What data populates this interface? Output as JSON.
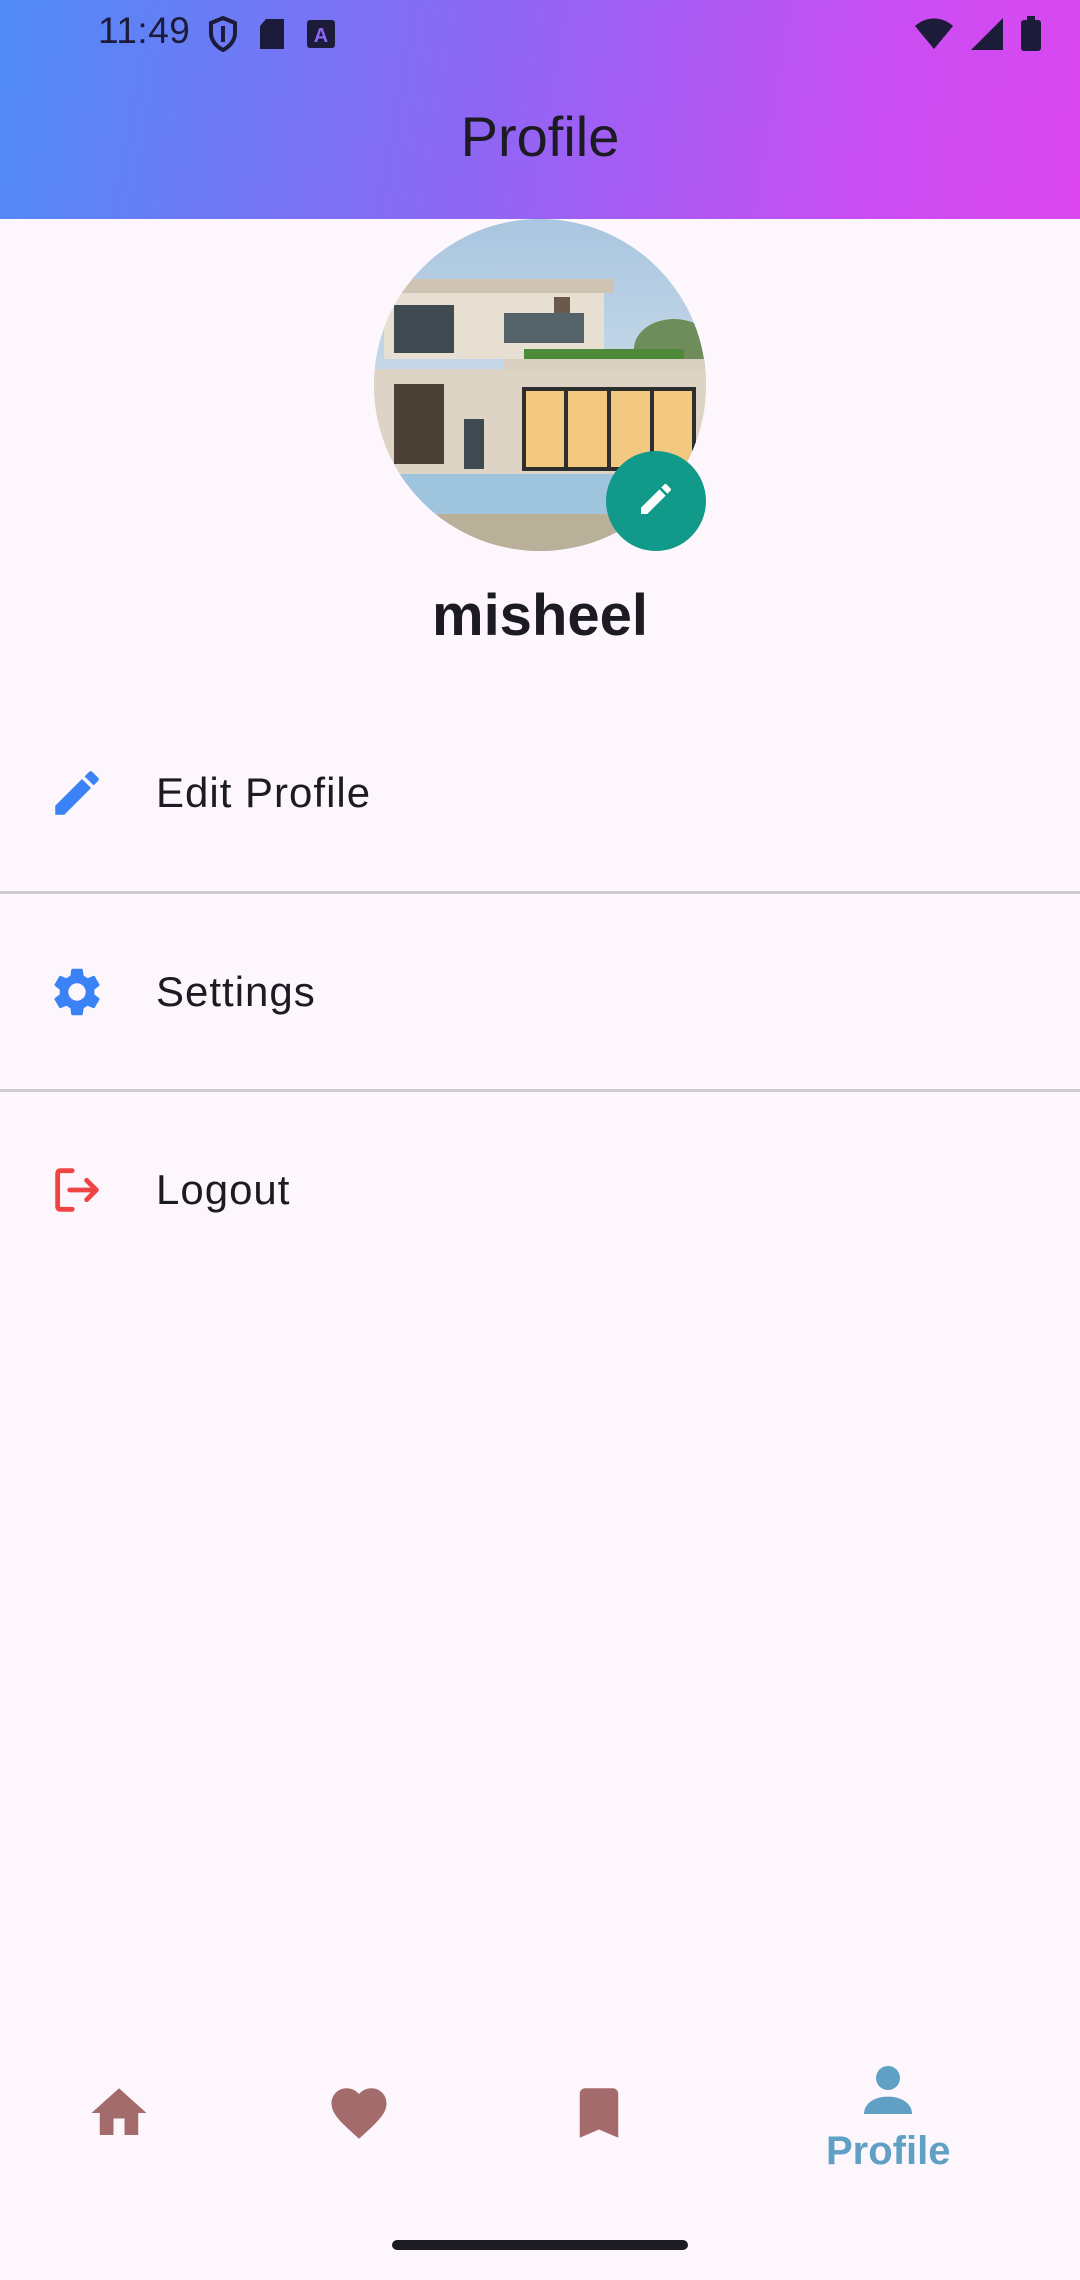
{
  "status_bar": {
    "time": "11:49",
    "left_icons": [
      "shield-icon",
      "sd-card-icon",
      "font-a-icon"
    ],
    "right_icons": [
      "wifi-icon",
      "signal-icon",
      "battery-icon"
    ]
  },
  "appbar": {
    "title": "Profile",
    "gradient": [
      "#4f8cf6",
      "#dc46f0"
    ]
  },
  "profile": {
    "avatar_alt": "house",
    "edit_badge_icon": "pencil-icon",
    "edit_badge_color": "#11998a",
    "username": "misheel"
  },
  "menu": {
    "items": [
      {
        "label": "Edit Profile",
        "icon": "pencil-icon",
        "icon_color": "#3b82f6"
      },
      {
        "label": "Settings",
        "icon": "gear-icon",
        "icon_color": "#3b82f6"
      },
      {
        "label": "Logout",
        "icon": "logout-icon",
        "icon_color": "#ef4444"
      }
    ]
  },
  "bottom_nav": {
    "items": [
      {
        "icon": "home-icon",
        "label": "",
        "color": "#a36b6b"
      },
      {
        "icon": "heart-icon",
        "label": "",
        "color": "#a36b6b"
      },
      {
        "icon": "bookmark-icon",
        "label": "",
        "color": "#a36b6b"
      },
      {
        "icon": "person-icon",
        "label": "Profile",
        "color": "#5fa0c4",
        "selected": true
      }
    ]
  }
}
